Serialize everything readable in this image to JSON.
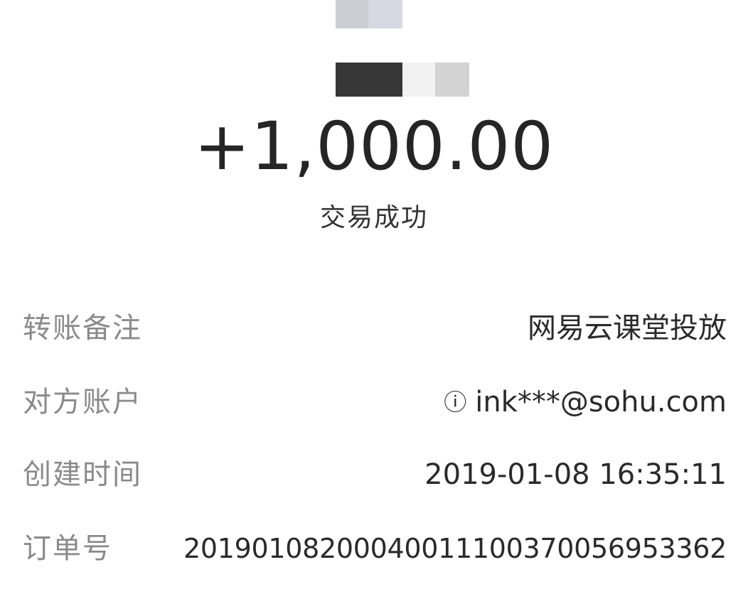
{
  "header": {
    "amount": "+1,000.00",
    "status": "交易成功"
  },
  "details": {
    "remark": {
      "label": "转账备注",
      "value": "网易云课堂投放"
    },
    "counterparty": {
      "label": "对方账户",
      "icon": "account-icon",
      "value": "ink***@sohu.com"
    },
    "created": {
      "label": "创建时间",
      "value": "2019-01-08 16:35:11"
    },
    "order": {
      "label": "订单号",
      "value": "20190108200040011100370056953362"
    }
  },
  "colors": {
    "text_primary": "#252525",
    "text_label": "#8a8a8a",
    "background": "#ffffff"
  }
}
